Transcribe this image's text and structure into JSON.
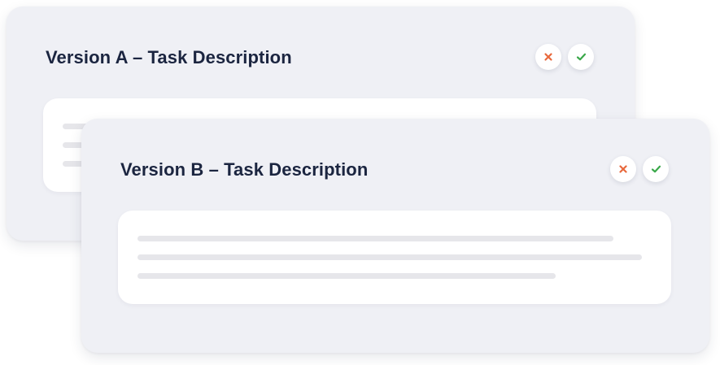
{
  "cards": [
    {
      "title": "Version A – Task Description",
      "actions": {
        "reject_icon": "close-icon",
        "accept_icon": "check-icon"
      }
    },
    {
      "title": "Version B – Task Description",
      "actions": {
        "reject_icon": "close-icon",
        "accept_icon": "check-icon"
      }
    }
  ],
  "colors": {
    "card_background": "#eff0f5",
    "content_background": "#ffffff",
    "title_text": "#1b2540",
    "reject_accent": "#e8683c",
    "accept_accent": "#3aa84a",
    "placeholder_line": "#e6e6ea"
  }
}
